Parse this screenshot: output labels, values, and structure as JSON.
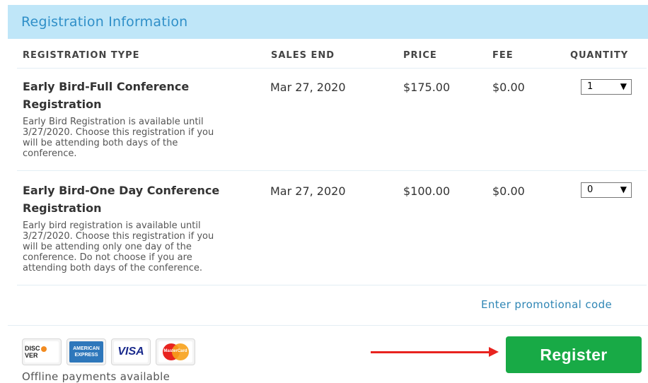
{
  "header": {
    "title": "Registration Information"
  },
  "table": {
    "columns": [
      "REGISTRATION TYPE",
      "SALES END",
      "PRICE",
      "FEE",
      "QUANTITY"
    ],
    "rows": [
      {
        "title_line1": "Early Bird-Full Conference",
        "title_line2": "Registration",
        "description": "Early Bird Registration is available until\n3/27/2020.  Choose this registration if you\nwill be attending both days of the\nconference.",
        "sales_end": "Mar 27, 2020",
        "price": "$175.00",
        "fee": "$0.00",
        "quantity": "1"
      },
      {
        "title_line1": "Early Bird-One Day Conference",
        "title_line2": "Registration",
        "description": "Early bird registration is available until\n3/27/2020. Choose this registration if you\nwill be attending only one day of the\nconference. Do not choose if you are\nattending both days of the conference.",
        "sales_end": "Mar 27, 2020",
        "price": "$100.00",
        "fee": "$0.00",
        "quantity": "0"
      }
    ]
  },
  "promo_link": "Enter promotional code",
  "payment": {
    "cards": [
      {
        "icon": "discover-card-icon",
        "label": "DISC",
        "label2": "VER"
      },
      {
        "icon": "amex-card-icon",
        "label": "AMERICAN",
        "label2": "EXPRESS"
      },
      {
        "icon": "visa-card-icon",
        "label": "VISA"
      },
      {
        "icon": "mastercard-card-icon",
        "label": "MasterCard"
      }
    ],
    "offline_text": "Offline payments available"
  },
  "register_button": "Register",
  "colors": {
    "header_bg": "#bfe6f8",
    "header_text": "#2f8fc8",
    "link": "#2f86b5",
    "register_bg": "#18aa46",
    "arrow": "#e8231f"
  }
}
